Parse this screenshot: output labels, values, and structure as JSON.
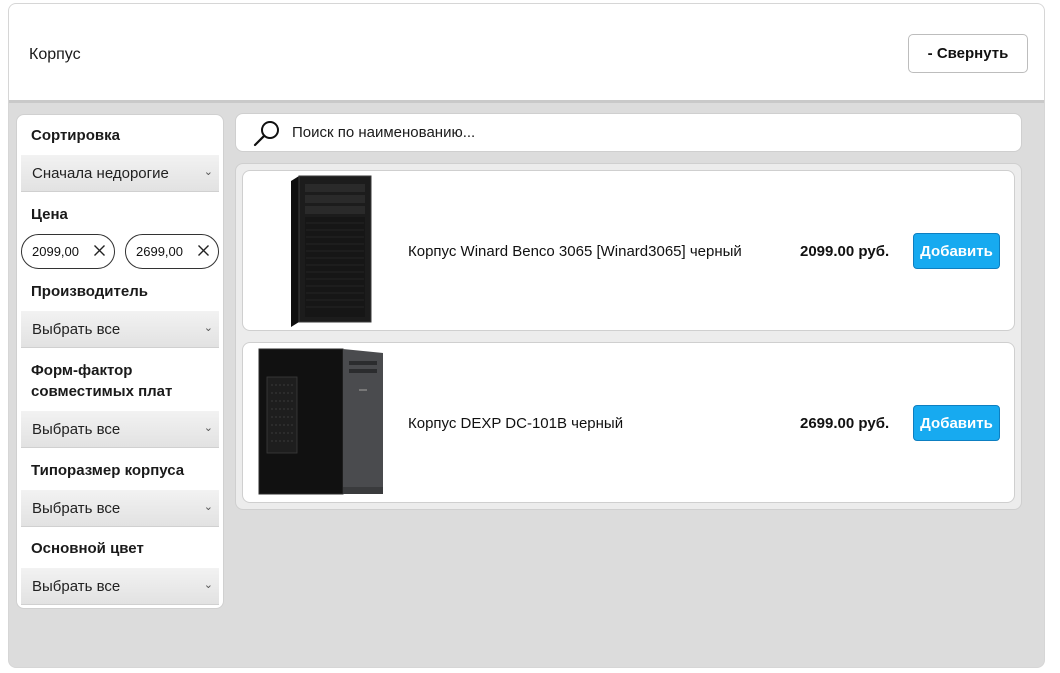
{
  "header": {
    "title": "Корпус",
    "collapse_label": "- Свернуть"
  },
  "filters": {
    "sort": {
      "label": "Сортировка",
      "value": "Сначала недорогие"
    },
    "price": {
      "label": "Цена",
      "min": "2099,00",
      "max": "2699,00"
    },
    "manufacturer": {
      "label": "Производитель",
      "value": "Выбрать все"
    },
    "form_factor": {
      "label_line1": "Форм-фактор",
      "label_line2": "совместимых плат",
      "value": "Выбрать все"
    },
    "case_size": {
      "label": "Типоразмер корпуса",
      "value": "Выбрать все"
    },
    "color": {
      "label": "Основной цвет",
      "value": "Выбрать все"
    },
    "chevron_icon": "chevron-down-icon",
    "clear_icon": "close-icon"
  },
  "search": {
    "placeholder": "Поиск по наименованию...",
    "icon": "search-icon"
  },
  "products": [
    {
      "name": "Корпус Winard Benco 3065 [Winard3065] черный",
      "price": "2099.00 руб.",
      "add_label": "Добавить"
    },
    {
      "name": "Корпус DEXP DC-101B черный",
      "price": "2699.00 руб.",
      "add_label": "Добавить"
    }
  ],
  "colors": {
    "accent": "#17aaf0",
    "background": "#dcdcdc"
  }
}
